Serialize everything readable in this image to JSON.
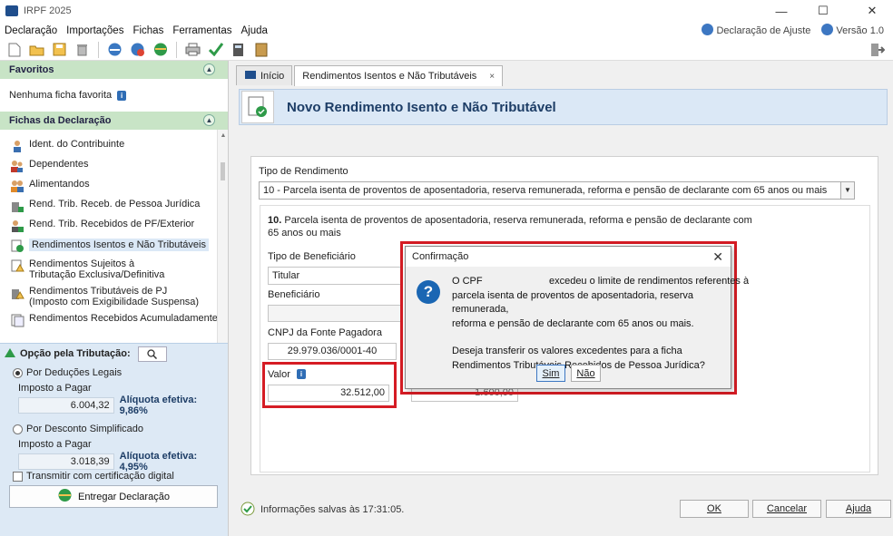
{
  "window": {
    "title": "IRPF 2025",
    "minimize": "—",
    "maximize": "☐",
    "close": "✕"
  },
  "menu": {
    "items": [
      "Declaração",
      "Importações",
      "Fichas",
      "Ferramentas",
      "Ajuda"
    ],
    "declaracao_ajuste": "Declaração de Ajuste",
    "versao": "Versão 1.0"
  },
  "left": {
    "favoritos_title": "Favoritos",
    "nenhuma_ficha": "Nenhuma ficha favorita",
    "fichas_title": "Fichas da Declaração",
    "fichas": [
      "Ident. do Contribuinte",
      "Dependentes",
      "Alimentandos",
      "Rend. Trib. Receb. de Pessoa Jurídica",
      "Rend. Trib. Recebidos de PF/Exterior",
      "Rendimentos Isentos e Não Tributáveis",
      "Rendimentos Sujeitos à Tributação Exclusiva/Definitiva",
      "Rendimentos Tributáveis de PJ (Imposto com Exigibilidade Suspensa)",
      "Rendimentos Recebidos Acumuladamente"
    ],
    "opcao_title": "Opção pela Tributação:",
    "deducoes_legais": "Por Deduções Legais",
    "imposto_pagar_label": "Imposto a Pagar",
    "imposto_legais": "6.004,32",
    "aliquota_legais": "Alíquota efetiva: 9,86%",
    "desconto_simplificado": "Por Desconto Simplificado",
    "imposto_simplificado": "3.018,39",
    "aliquota_simplificado": "Alíquota efetiva: 4,95%",
    "transmitir": "Transmitir com certificação digital",
    "entregar": "Entregar Declaração"
  },
  "tabs": {
    "inicio": "Início",
    "rendimentos": "Rendimentos Isentos e Não Tributáveis",
    "close": "×"
  },
  "header": {
    "title": "Novo Rendimento Isento e Não Tributável"
  },
  "form": {
    "tipo_rendimento_label": "Tipo de Rendimento",
    "tipo_rendimento_value": "10 - Parcela isenta de proventos de aposentadoria, reserva remunerada, reforma e pensão de declarante com 65 anos ou mais",
    "desc_number": "10.",
    "desc_text": "Parcela isenta de proventos de aposentadoria, reserva remunerada, reforma e pensão de declarante com 65 anos ou mais",
    "tipo_beneficiario_label": "Tipo de Beneficiário",
    "tipo_beneficiario_value": "Titular",
    "beneficiario_label": "Beneficiário",
    "cnpj_label": "CNPJ da Fonte Pagadora",
    "cnpj_value": "29.979.036/0001-40",
    "valor_label": "Valor",
    "valor_value": "32.512,00",
    "hidden_value": "1.600,00"
  },
  "status": {
    "saved": "Informações salvas às 17:31:05."
  },
  "buttons": {
    "ok": "OK",
    "cancelar": "Cancelar",
    "ajuda": "Ajuda"
  },
  "dialog": {
    "title": "Confirmação",
    "close": "✕",
    "line1": "O CPF                        excedeu o limite de rendimentos referentes à",
    "line2": "parcela isenta de proventos de aposentadoria, reserva remunerada,",
    "line3": "reforma e pensão de declarante com 65 anos ou mais.",
    "line4": "Deseja transferir os valores excedentes para a ficha",
    "line5": "Rendimentos Tributáveis Recebidos de Pessoa Jurídica?",
    "sim": "Sim",
    "nao": "Não"
  },
  "colors": {
    "highlight_red": "#d51c24",
    "header_blue": "#1d3d66",
    "section_green": "#c8e4c6"
  }
}
